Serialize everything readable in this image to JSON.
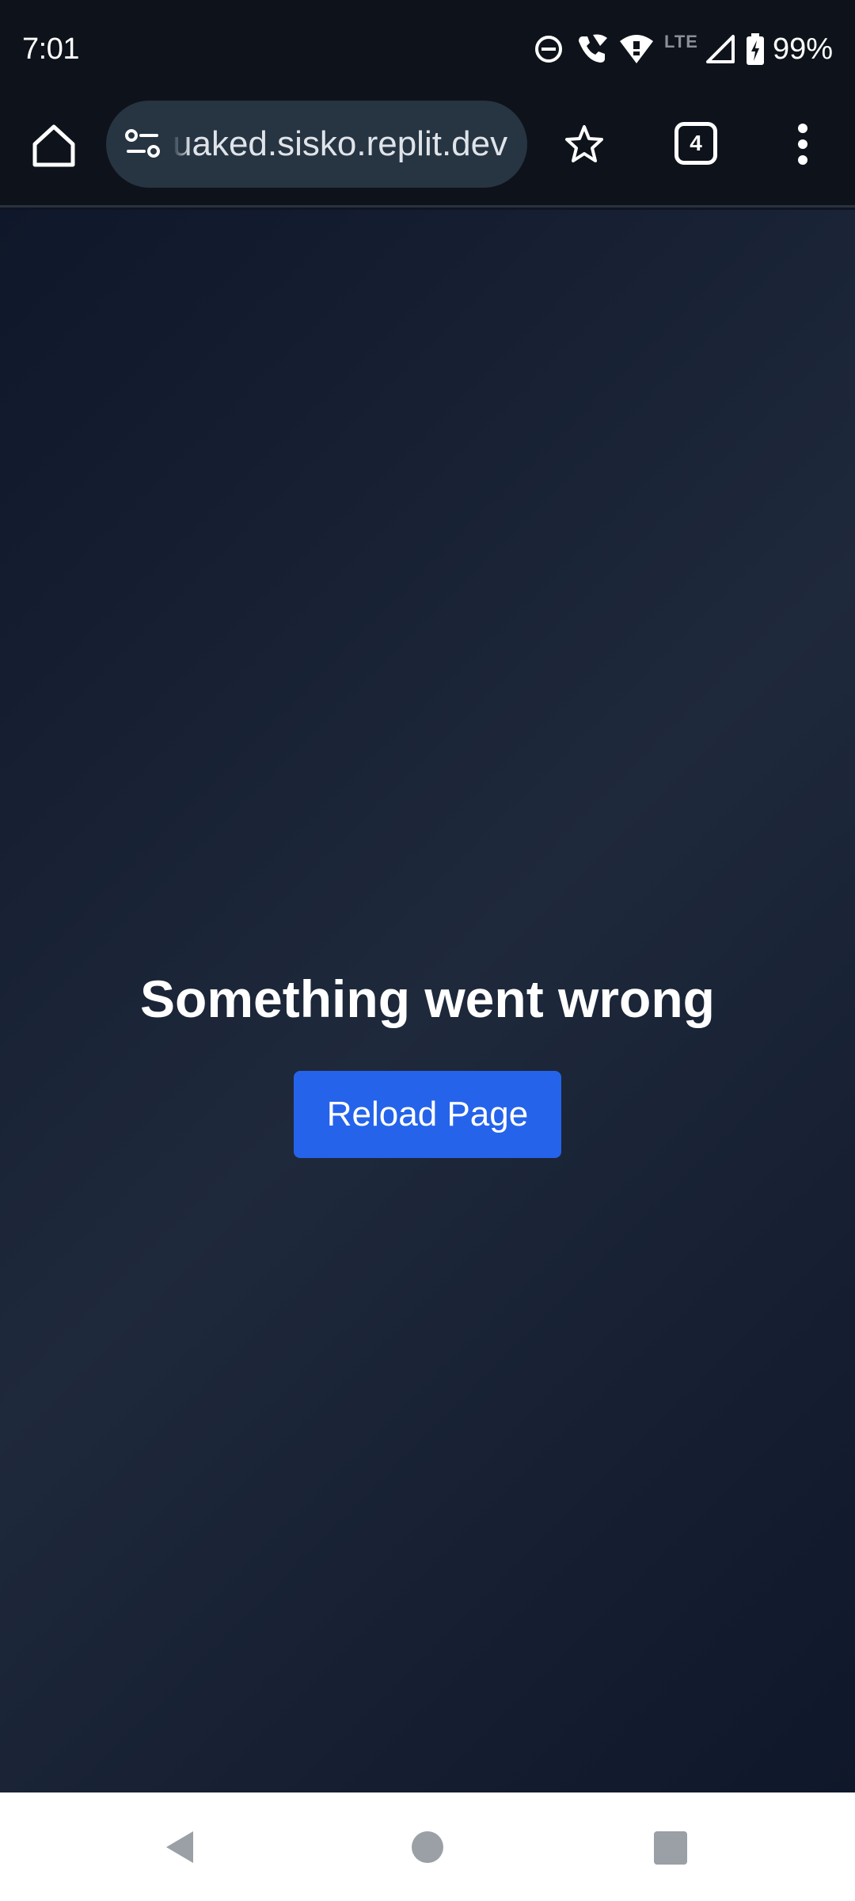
{
  "status_bar": {
    "time": "7:01",
    "network_type": "LTE",
    "battery": "99%",
    "icons": [
      "do-not-disturb-icon",
      "wifi-calling-icon",
      "wifi-icon",
      "cell-signal-icon",
      "battery-charging-icon"
    ]
  },
  "browser": {
    "url": "uaked.sisko.replit.dev",
    "tab_count": "4",
    "icons": [
      "home-icon",
      "site-settings-icon",
      "bookmark-star-icon",
      "tab-switcher-icon",
      "overflow-menu-icon"
    ]
  },
  "page": {
    "title": "Something went wrong",
    "reload_label": "Reload Page",
    "colors": {
      "background_dark": "#0f172a",
      "background_mid": "#1e293b",
      "button": "#2563eb"
    }
  },
  "nav_bar": {
    "icons": [
      "back-icon",
      "home-circle-icon",
      "recents-icon"
    ]
  }
}
